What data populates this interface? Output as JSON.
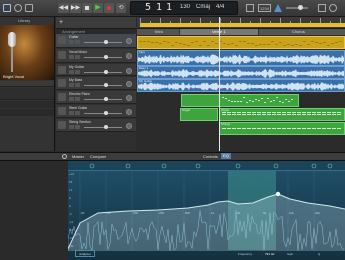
{
  "toolbar": {
    "lcd_bar": "5",
    "lcd_beat": "1",
    "lcd_sub": "1",
    "lcd_tempo": "130",
    "lcd_key": "Cmaj",
    "lcd_sig": "4/4",
    "badge": "1234"
  },
  "library": {
    "title": "Library",
    "patch_name": "Bright Vocal"
  },
  "tracks": {
    "header_label": "Arrangement",
    "names": [
      "Guitar",
      "Vocal Mono",
      "My Guitar",
      "My Bass",
      "Electric Piano",
      "Steel Guitar",
      "String Section"
    ]
  },
  "sections": [
    "Intro",
    "Verse 1",
    "Chorus"
  ],
  "region_labels": [
    "Intro",
    "Bass 1",
    "My Guitar",
    "Organ",
    "Organ",
    "Strings"
  ],
  "editor": {
    "tab_master": "Master",
    "tab_compare": "Compare",
    "controls_label": "Controls",
    "eq_label": "EQ",
    "freq_labels": [
      "20",
      "50",
      "100",
      "200",
      "500",
      "1k",
      "2k",
      "5k",
      "10k",
      "20k"
    ],
    "db_labels": [
      "+24",
      "18",
      "12",
      "6",
      "0",
      "-6",
      "-12",
      "-18",
      "-24",
      "-30"
    ],
    "readout_frequency": "Frequency",
    "readout_value": "791 Hz",
    "readout_gain": "Gain",
    "readout_q": "Q",
    "analyzer_label": "Analyzer"
  },
  "colors": {
    "audio_region": "#3f7fbf",
    "midi_region": "#3fa43f",
    "yellow_region": "#c9a41a",
    "eq_curve": "#cfe8f0",
    "eq_background": "#1a3a4e"
  }
}
